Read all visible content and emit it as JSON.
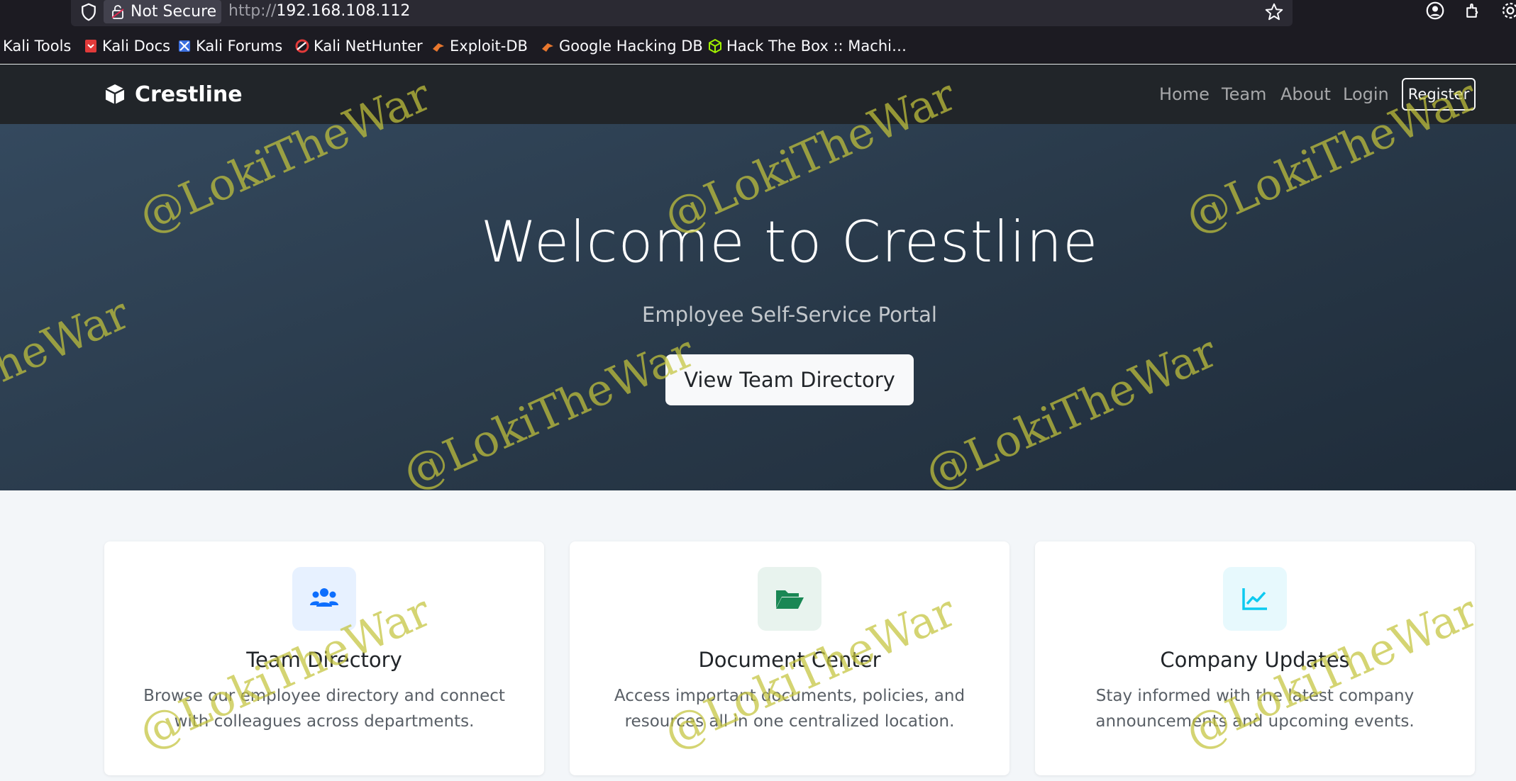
{
  "browser": {
    "not_secure_label": "Not Secure",
    "url_protocol": "http://",
    "url_host": "192.168.108.112",
    "bookmarks": [
      {
        "label": "Kali Tools",
        "icon": "kali-icon",
        "color": "#1c1b22"
      },
      {
        "label": "Kali Docs",
        "icon": "kali-docs-icon",
        "color": "#e23a3a"
      },
      {
        "label": "Kali Forums",
        "icon": "kali-forums-icon",
        "color": "#3b6fe0"
      },
      {
        "label": "Kali NetHunter",
        "icon": "nethunter-icon",
        "color": "#e23a3a"
      },
      {
        "label": "Exploit-DB",
        "icon": "exploit-db-icon",
        "color": "#e8772e"
      },
      {
        "label": "Google Hacking DB",
        "icon": "ghdb-icon",
        "color": "#e8772e"
      },
      {
        "label": "Hack The Box :: Machi…",
        "icon": "hackthebox-icon",
        "color": "#9fef00"
      }
    ]
  },
  "site": {
    "brand": "Crestline",
    "nav": {
      "home": "Home",
      "team": "Team",
      "about": "About",
      "login": "Login",
      "register": "Register"
    },
    "hero": {
      "title": "Welcome to Crestline",
      "subtitle": "Employee Self-Service Portal",
      "button": "View Team Directory"
    },
    "cards": [
      {
        "title": "Team Directory",
        "description": "Browse our employee directory and connect with colleagues across departments.",
        "icon": "users-icon",
        "icon_color": "#0d6efd",
        "icon_bg": "#e7f1ff"
      },
      {
        "title": "Document Center",
        "description": "Access important documents, policies, and resources all in one centralized location.",
        "icon": "folder-open-icon",
        "icon_color": "#198754",
        "icon_bg": "#e8f3ee"
      },
      {
        "title": "Company Updates",
        "description": "Stay informed with the latest company announcements and upcoming events.",
        "icon": "chart-line-icon",
        "icon_color": "#0dcaf0",
        "icon_bg": "#e7f9fd"
      }
    ]
  },
  "watermark": "@LokiTheWar"
}
